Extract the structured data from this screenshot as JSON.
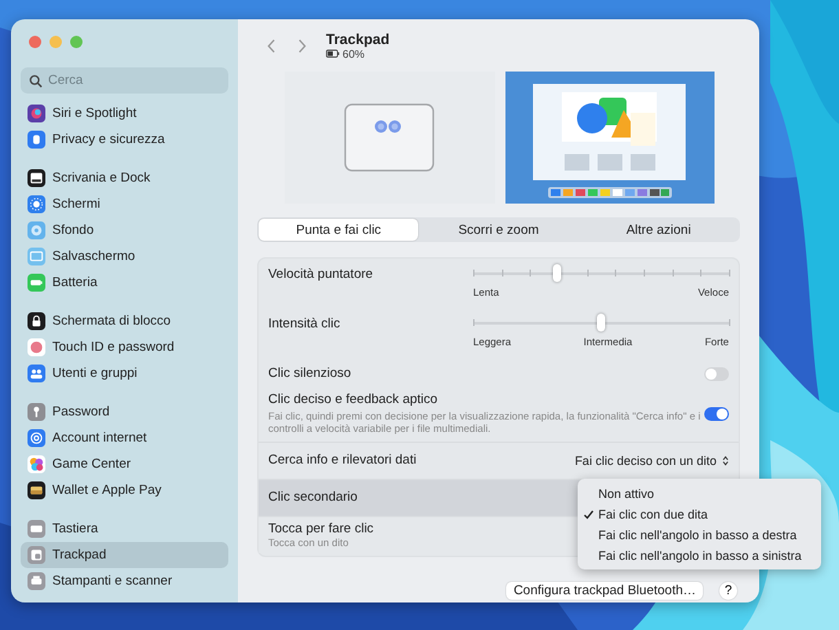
{
  "sidebar": {
    "search": {
      "placeholder": "Cerca"
    },
    "groups": [
      {
        "items": [
          {
            "label": "Siri e Spotlight",
            "selected": false
          },
          {
            "label": "Privacy e sicurezza",
            "selected": false
          }
        ]
      },
      {
        "items": [
          {
            "label": "Scrivania e Dock",
            "selected": false
          },
          {
            "label": "Schermi",
            "selected": false
          },
          {
            "label": "Sfondo",
            "selected": false
          },
          {
            "label": "Salvaschermo",
            "selected": false
          },
          {
            "label": "Batteria",
            "selected": false
          }
        ]
      },
      {
        "items": [
          {
            "label": "Schermata di blocco",
            "selected": false
          },
          {
            "label": "Touch ID e password",
            "selected": false
          },
          {
            "label": "Utenti e gruppi",
            "selected": false
          }
        ]
      },
      {
        "items": [
          {
            "label": "Password",
            "selected": false
          },
          {
            "label": "Account internet",
            "selected": false
          },
          {
            "label": "Game Center",
            "selected": false
          },
          {
            "label": "Wallet e Apple Pay",
            "selected": false
          }
        ]
      },
      {
        "items": [
          {
            "label": "Tastiera",
            "selected": false
          },
          {
            "label": "Trackpad",
            "selected": true
          },
          {
            "label": "Stampanti e scanner",
            "selected": false
          }
        ]
      }
    ]
  },
  "header": {
    "title": "Trackpad",
    "battery": "60%"
  },
  "tabs": [
    {
      "label": "Punta e fai clic",
      "selected": true
    },
    {
      "label": "Scorri e zoom",
      "selected": false
    },
    {
      "label": "Altre azioni",
      "selected": false
    }
  ],
  "settings": [
    {
      "kind": "slider",
      "label": "Velocità puntatore",
      "level": 0.33,
      "scale": [
        "Lenta",
        "Veloce"
      ]
    },
    {
      "kind": "slider",
      "label": "Intensità clic",
      "level": 0.5,
      "scale": [
        "Leggera",
        "Intermedia",
        "Forte"
      ]
    },
    {
      "kind": "toggle",
      "label": "Clic silenzioso",
      "on": false
    },
    {
      "kind": "toggle",
      "label": "Clic deciso e feedback aptico",
      "on": true,
      "description": "Fai clic, quindi premi con decisione per la visualizzazione rapida, la funzionalità \"Cerca info\" e i controlli a velocità variabile per i file multimediali."
    },
    {
      "kind": "popup",
      "label": "Cerca info e rilevatori dati",
      "value": "Fai clic deciso con un dito",
      "selected": false
    },
    {
      "kind": "popup",
      "label": "Clic secondario",
      "selected": true
    },
    {
      "kind": "popup",
      "label": "Tocca per fare clic",
      "subtitle": "Tocca con un dito",
      "selected": false
    }
  ],
  "menu": [
    {
      "label": "Non attivo",
      "selected": false
    },
    {
      "label": "Fai clic con due dita",
      "selected": true
    },
    {
      "label": "Fai clic nell'angolo in basso a destra",
      "selected": false
    },
    {
      "label": "Fai clic nell'angolo in basso a sinistra",
      "selected": false
    }
  ],
  "footer": {
    "button": "Configura trackpad Bluetooth…",
    "help": "?"
  }
}
